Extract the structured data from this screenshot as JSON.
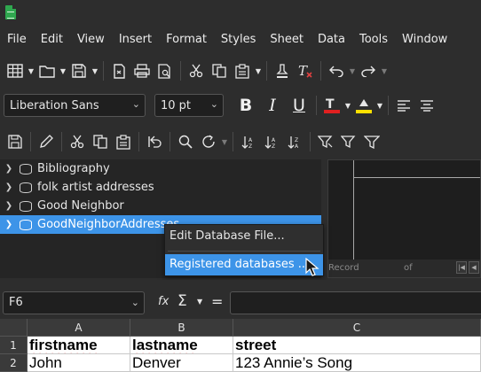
{
  "menubar": {
    "items": [
      "File",
      "Edit",
      "View",
      "Insert",
      "Format",
      "Styles",
      "Sheet",
      "Data",
      "Tools",
      "Window"
    ]
  },
  "toolbar_format": {
    "font_name": "Liberation Sans",
    "font_size": "10 pt",
    "bold_label": "B",
    "italic_label": "I",
    "underline_label": "U",
    "font_color": "#e02020",
    "highlight_color": "#ffe000"
  },
  "datasources": {
    "items": [
      {
        "label": "Bibliography",
        "selected": false
      },
      {
        "label": "folk artist addresses",
        "selected": false
      },
      {
        "label": "Good Neighbor",
        "selected": false
      },
      {
        "label": "GoodNeighborAddresses",
        "selected": true
      }
    ]
  },
  "context_menu": {
    "items": [
      {
        "label": "Edit Database File...",
        "highlighted": false
      },
      {
        "label": "Registered databases ...",
        "highlighted": true
      }
    ]
  },
  "preview": {
    "record_label": "Record",
    "of_label": "of"
  },
  "formula_bar": {
    "cell_ref": "F6",
    "fx_label": "fx",
    "sigma_label": "Σ",
    "equals_label": "=",
    "formula": ""
  },
  "sheet": {
    "columns": [
      "A",
      "B",
      "C"
    ],
    "rows": [
      {
        "num": "1",
        "cells": [
          "firstname",
          "lastname",
          "street"
        ]
      },
      {
        "num": "2",
        "cells": [
          "John",
          "Denver",
          "123 Annie’s Song"
        ]
      }
    ]
  },
  "colors": {
    "accent": "#3d94e8",
    "background": "#2d2d2d"
  }
}
